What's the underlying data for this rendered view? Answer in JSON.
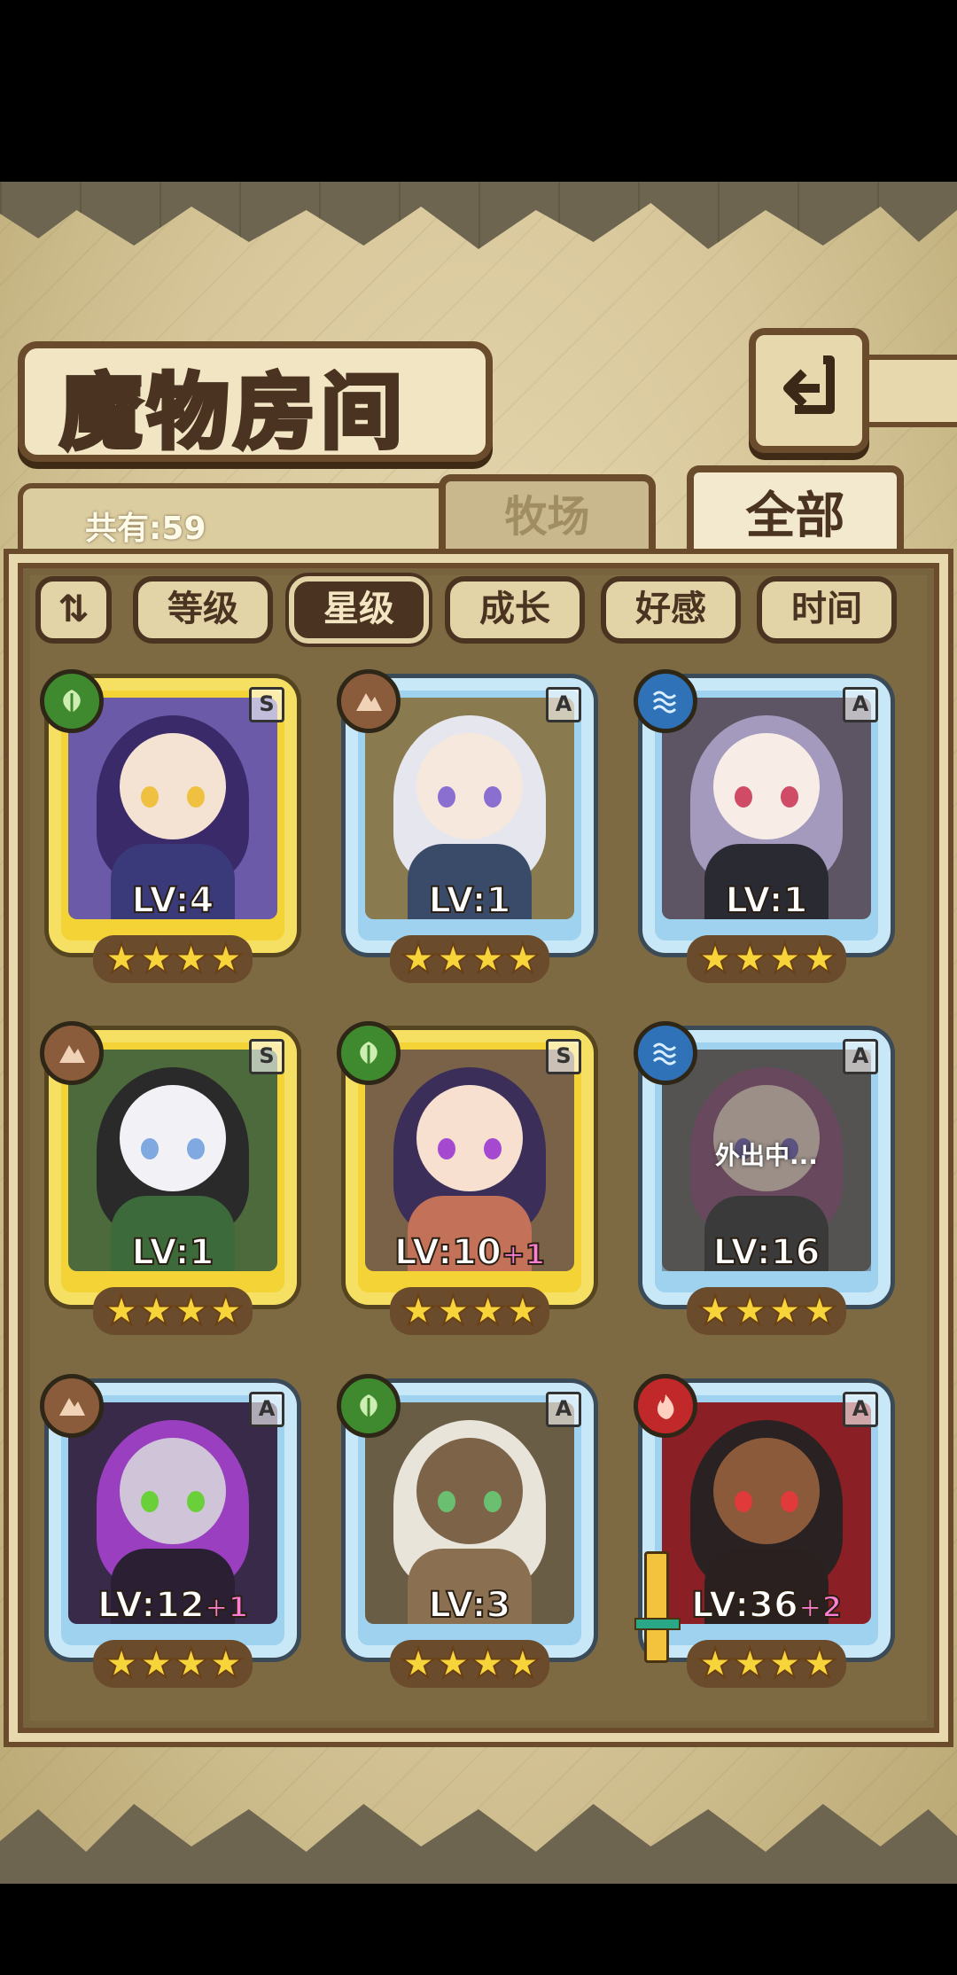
{
  "header": {
    "title": "魔物房间",
    "back_icon": "return-icon"
  },
  "summary": {
    "count_label": "共有:59"
  },
  "tabs": [
    {
      "label": "牧场",
      "selected": false
    },
    {
      "label": "全部",
      "selected": true
    }
  ],
  "filters": {
    "sort_toggle": "⇅",
    "buttons": [
      {
        "label": "等级",
        "active": false
      },
      {
        "label": "星级",
        "active": true
      },
      {
        "label": "成长",
        "active": false
      },
      {
        "label": "好感",
        "active": false
      },
      {
        "label": "时间",
        "active": false
      }
    ]
  },
  "monsters": [
    {
      "element": "leaf",
      "rank": "S",
      "frame": "gold",
      "level": "LV:4",
      "bonus": "",
      "stars": "★★★★",
      "status": ""
    },
    {
      "element": "earth",
      "rank": "A",
      "frame": "blue",
      "level": "LV:1",
      "bonus": "",
      "stars": "★★★★",
      "status": ""
    },
    {
      "element": "water",
      "rank": "A",
      "frame": "blue",
      "level": "LV:1",
      "bonus": "",
      "stars": "★★★★",
      "status": ""
    },
    {
      "element": "earth",
      "rank": "S",
      "frame": "gold",
      "level": "LV:1",
      "bonus": "",
      "stars": "★★★★",
      "status": ""
    },
    {
      "element": "leaf",
      "rank": "S",
      "frame": "gold",
      "level": "LV:10",
      "bonus": "+1",
      "stars": "★★★★",
      "status": ""
    },
    {
      "element": "water",
      "rank": "A",
      "frame": "blue",
      "level": "LV:16",
      "bonus": "",
      "stars": "★★★★",
      "status": "外出中..."
    },
    {
      "element": "earth",
      "rank": "A",
      "frame": "blue",
      "level": "LV:12",
      "bonus": "+1",
      "stars": "★★★★",
      "status": ""
    },
    {
      "element": "leaf",
      "rank": "A",
      "frame": "blue",
      "level": "LV:3",
      "bonus": "",
      "stars": "★★★★",
      "status": ""
    },
    {
      "element": "fire",
      "rank": "A",
      "frame": "blue",
      "level": "LV:36",
      "bonus": "+2",
      "stars": "★★★★",
      "status": ""
    }
  ]
}
